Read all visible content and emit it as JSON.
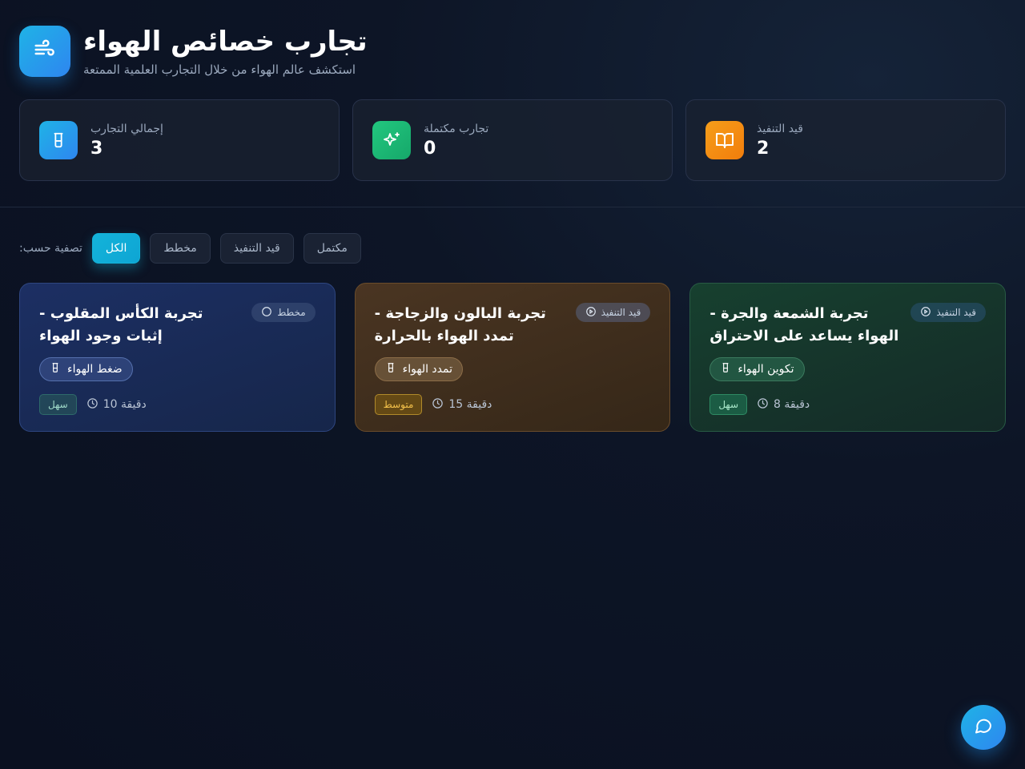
{
  "header": {
    "title": "تجارب خصائص الهواء",
    "subtitle": "استكشف عالم الهواء من خلال التجارب العلمية الممتعة",
    "logo_icon": "wind-icon"
  },
  "stats": [
    {
      "label": "إجمالي التجارب",
      "value": "3",
      "icon": "beaker-icon",
      "color": "#2e9be8"
    },
    {
      "label": "تجارب مكتملة",
      "value": "0",
      "icon": "sparkles-icon",
      "color": "#1fbf7a"
    },
    {
      "label": "قيد التنفيذ",
      "value": "2",
      "icon": "book-open-icon",
      "color": "#f5880f"
    }
  ],
  "filters": {
    "label": ":تصفية حسب",
    "options": [
      "الكل",
      "مخطط",
      "قيد التنفيذ",
      "مكتمل"
    ],
    "selected": "الكل"
  },
  "cards": [
    {
      "title": "تجربة الكأس المقلوب - إثبات وجود الهواء",
      "status": "مخطط",
      "status_icon": "circle-icon",
      "concept": "ضغط الهواء",
      "level": "سهل",
      "duration": "10 دقيقة",
      "theme": "blue"
    },
    {
      "title": "تجربة البالون والزجاجة - تمدد الهواء بالحرارة",
      "status": "قيد التنفيذ",
      "status_icon": "play-circle-icon",
      "concept": "تمدد الهواء",
      "level": "متوسط",
      "duration": "15 دقيقة",
      "theme": "brown"
    },
    {
      "title": "تجربة الشمعة والجرة - الهواء يساعد على الاحتراق",
      "status": "قيد التنفيذ",
      "status_icon": "play-circle-icon",
      "concept": "تكوين الهواء",
      "level": "سهل",
      "duration": "8 دقيقة",
      "theme": "green"
    }
  ],
  "chat": {
    "icon": "message-circle-icon"
  }
}
